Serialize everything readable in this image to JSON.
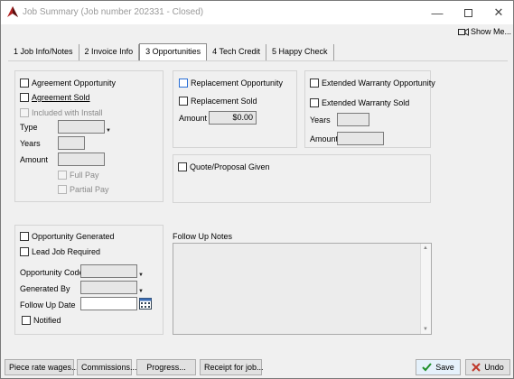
{
  "window": {
    "title": "Job Summary  (Job number 202331 - Closed)"
  },
  "show_me": "Show Me...",
  "tabs": [
    "1 Job Info/Notes",
    "2 Invoice Info",
    "3 Opportunities",
    "4 Tech Credit",
    "5 Happy Check"
  ],
  "agreement": {
    "opportunity": "Agreement Opportunity",
    "sold": "Agreement Sold",
    "included": "Included with Install",
    "type_label": "Type",
    "years_label": "Years",
    "amount_label": "Amount",
    "full_pay": "Full Pay",
    "partial_pay": "Partial Pay"
  },
  "replacement": {
    "opportunity": "Replacement Opportunity",
    "sold": "Replacement Sold",
    "amount_label": "Amount",
    "amount_value": "$0.00"
  },
  "warranty": {
    "opportunity": "Extended Warranty Opportunity",
    "sold": "Extended Warranty Sold",
    "years_label": "Years",
    "amount_label": "Amount"
  },
  "quote": "Quote/Proposal Given",
  "opportunity": {
    "generated": "Opportunity Generated",
    "lead_required": "Lead Job Required",
    "code_label": "Opportunity Code",
    "generated_by_label": "Generated By",
    "follow_up_date_label": "Follow Up Date",
    "notified": "Notified"
  },
  "follow_up_notes_label": "Follow Up Notes",
  "buttons": {
    "piece_rate": "Piece rate wages...",
    "commissions": "Commissions...",
    "progress": "Progress...",
    "receipt": "Receipt for job...",
    "save": "Save",
    "undo": "Undo"
  },
  "colors": {
    "accent_blue": "#2a6fd6",
    "save_check": "#1f8f2a",
    "undo_x": "#c0392b"
  }
}
